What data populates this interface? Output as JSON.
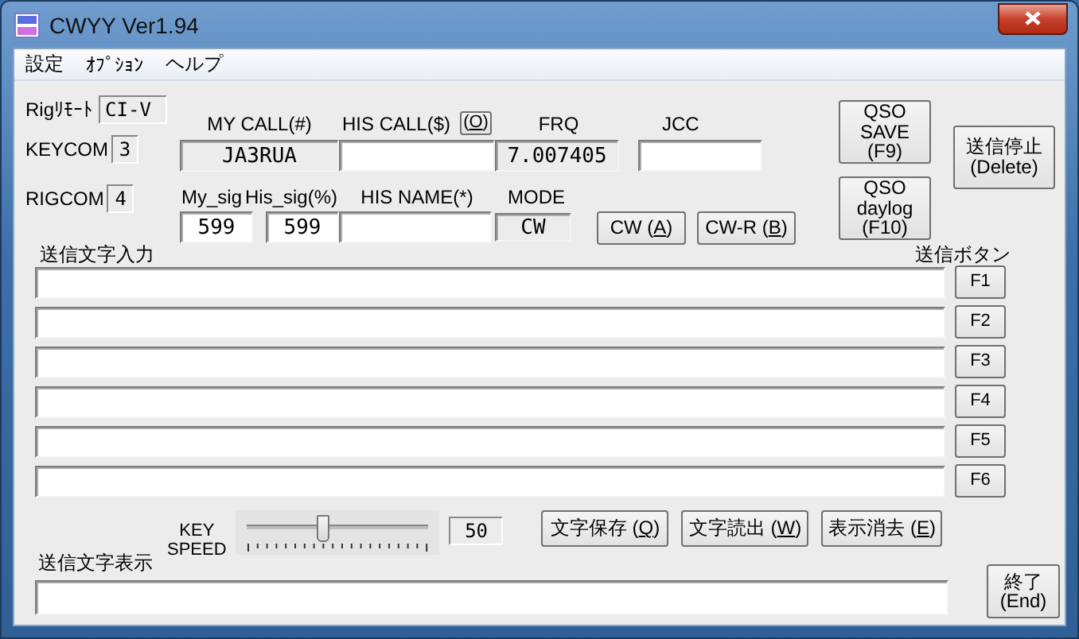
{
  "window": {
    "title": "CWYY Ver1.94"
  },
  "menu": [
    {
      "label": "設定"
    },
    {
      "label": "ｵﾌﾟｼｮﾝ"
    },
    {
      "label": "ヘルプ"
    }
  ],
  "rig": {
    "remote_label": "Rigﾘﾓｰﾄ",
    "remote_value": "CI-V",
    "keycom_label": "KEYCOM",
    "keycom_value": "3",
    "rigcom_label": "RIGCOM",
    "rigcom_value": "4"
  },
  "my_call": {
    "label": "MY CALL(#)",
    "value": "JA3RUA"
  },
  "his_call": {
    "label": "HIS CALL($)",
    "button": {
      "before": "(",
      "accel": "O",
      "after": ")"
    }
  },
  "frq": {
    "label": "FRQ",
    "value": "7.007405"
  },
  "jcc": {
    "label": "JCC"
  },
  "my_sig": {
    "label": "My_sig",
    "value": "599"
  },
  "his_sig": {
    "label": "His_sig(%)",
    "value": "599"
  },
  "his_name": {
    "label": "HIS NAME(*)"
  },
  "mode": {
    "label": "MODE",
    "value": "CW"
  },
  "mode_buttons": [
    {
      "before": "CW (",
      "accel": "A",
      "after": ")"
    },
    {
      "before": "CW-R (",
      "accel": "B",
      "after": ")"
    }
  ],
  "qso_buttons": [
    {
      "lines": [
        "QSO",
        "SAVE",
        "(F9)"
      ]
    },
    {
      "lines": [
        "QSO",
        "daylog",
        "(F10)"
      ]
    }
  ],
  "stop_button": {
    "lines": [
      "送信停止",
      "(Delete)"
    ]
  },
  "send_input": {
    "label": "送信文字入力",
    "buttons_label": "送信ボタン",
    "rows": [
      {
        "key": "F1"
      },
      {
        "key": "F2"
      },
      {
        "key": "F3"
      },
      {
        "key": "F4"
      },
      {
        "key": "F5"
      },
      {
        "key": "F6"
      }
    ]
  },
  "key_speed": {
    "label_lines": [
      "KEY",
      "SPEED"
    ],
    "level": 0.42,
    "value": "50"
  },
  "text_buttons": [
    {
      "before": "文字保存 (",
      "accel": "Q",
      "after": ")"
    },
    {
      "before": "文字読出 (",
      "accel": "W",
      "after": ")"
    },
    {
      "before": "表示消去 (",
      "accel": "E",
      "after": ")"
    }
  ],
  "send_display": {
    "label": "送信文字表示"
  },
  "end_button": {
    "lines": [
      "終了",
      "(End)"
    ]
  }
}
